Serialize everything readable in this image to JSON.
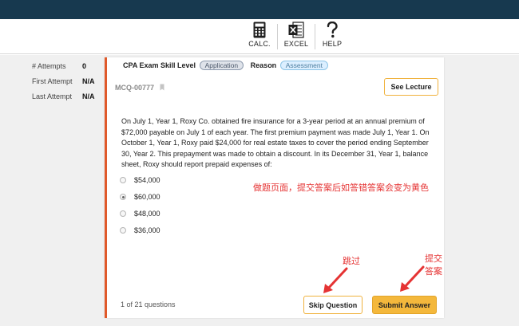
{
  "toolbar": {
    "calc_label": "CALC.",
    "excel_label": "EXCEL",
    "help_label": "HELP"
  },
  "stats": {
    "attempts_label": "# Attempts",
    "attempts_value": "0",
    "first_attempt_label": "First Attempt",
    "first_attempt_value": "N/A",
    "last_attempt_label": "Last Attempt",
    "last_attempt_value": "N/A"
  },
  "card": {
    "skill_level_label": "CPA Exam Skill Level",
    "skill_level_value": "Application",
    "reason_label": "Reason",
    "reason_value": "Assessment",
    "question_id": "MCQ-00777",
    "see_lecture_label": "See Lecture",
    "question_text": "On July 1, Year 1, Roxy Co. obtained fire insurance for a 3-year period at an annual premium of $72,000 payable on July 1 of each year. The first premium payment was made July 1, Year 1. On October 1, Year 1, Roxy paid $24,000 for real estate taxes to cover the period ending September 30, Year 2. This prepayment was made to obtain a discount. In its December 31, Year 1, balance sheet, Roxy should report prepaid expenses of:",
    "choices": [
      {
        "label": "$54,000",
        "selected": false
      },
      {
        "label": "$60,000",
        "selected": true
      },
      {
        "label": "$48,000",
        "selected": false
      },
      {
        "label": "$36,000",
        "selected": false
      }
    ],
    "progress_text": "1 of 21 questions",
    "skip_label": "Skip Question",
    "submit_label": "Submit Answer"
  },
  "annotations": {
    "main_note": "做题页面，提交答案后如答错答案会变为黄色",
    "skip_note": "跳过",
    "submit_note": "提交答案"
  },
  "colors": {
    "topbar": "#17394f",
    "accent_orange": "#e0592a",
    "button_yellow": "#f4b83c",
    "annotation_red": "#e53333"
  },
  "icons": {
    "calc": "calculator-icon",
    "excel": "excel-icon",
    "help": "question-mark-icon",
    "bookmark": "bookmark-icon"
  }
}
